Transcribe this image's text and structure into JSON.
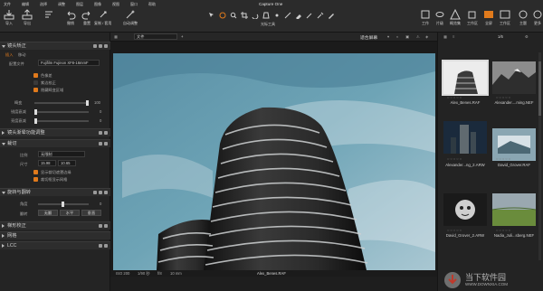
{
  "window": {
    "title": "Capture One"
  },
  "menu": [
    "文件",
    "编辑",
    "选择",
    "调整",
    "图层",
    "图像",
    "视图",
    "窗口",
    "帮助"
  ],
  "toolbar": {
    "import": "导入",
    "export": "导出",
    "undo": "撤销",
    "redo": "重置",
    "reset": "复制 / 套用",
    "auto": "自动调整",
    "cursor_tools": "光标工具",
    "right_buttons": [
      "工作",
      "片级",
      "概览集",
      "工作区",
      "全屏",
      "工作区",
      "主题",
      "更多"
    ]
  },
  "left_panel": {
    "sections": {
      "lens": "镜头矫正",
      "vignette": "镜头渐晕功能调整",
      "crop": "裁切",
      "rotate": "旋转与翻转",
      "keystone": "梯形校正",
      "grid": "网格",
      "lcc": "LCC"
    },
    "tabs": [
      "插入",
      "移动"
    ],
    "lens": {
      "profile_label": "配置文件",
      "profile_value": "Fujifilm Fujinon XF8-16mmF",
      "options": [
        "色像差",
        "紫边校正",
        "隐藏畸变区域"
      ],
      "sliders": [
        {
          "label": "畸变",
          "value": "100"
        },
        {
          "label": "锐度衰减",
          "value": "0"
        },
        {
          "label": "亮度衰减",
          "value": "0"
        }
      ]
    },
    "crop": {
      "ratio_label": "比例",
      "ratio_value": "无限制",
      "size_label": "尺寸",
      "w": "15.98",
      "h": "10.65",
      "options": [
        "显示裁切遮罩边缘",
        "裁切框显示网格"
      ]
    },
    "rotate": {
      "angle_label": "角度",
      "angle_value": "0",
      "flip_label": "翻转",
      "buttons": [
        "无翻",
        "水平",
        "垂直"
      ]
    }
  },
  "viewer": {
    "tab": "文件",
    "fit": "适合屏幕",
    "page": "1/6",
    "status": {
      "iso": "ISO 200",
      "shutter": "1/90 秒",
      "aperture": "f/8",
      "focal": "10 mm",
      "filename": "Alex_Benes.RAF"
    }
  },
  "browser": {
    "thumbs": [
      {
        "name": "Alex_Benes.RAF"
      },
      {
        "name": "Alexander....ming.NEF"
      },
      {
        "name": "Alexander...ng_2.ARW"
      },
      {
        "name": "David_Grover.RAF"
      },
      {
        "name": "David_Grover_2.ARW"
      },
      {
        "name": "Nadia_Juli...sberg.NEF"
      }
    ]
  },
  "watermark": {
    "name": "当下软件园",
    "url": "WWW.DOWNXIA.COM"
  }
}
